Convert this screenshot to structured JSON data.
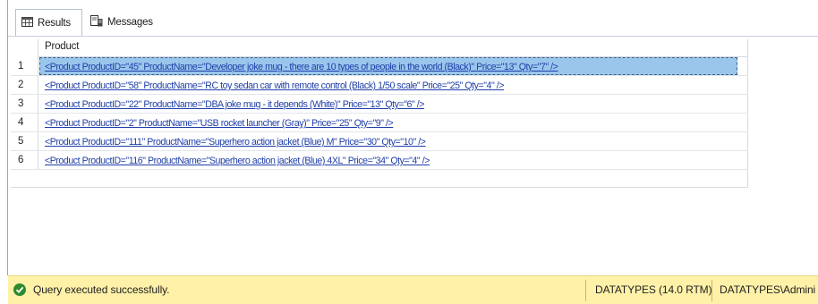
{
  "tabs": {
    "results_label": "Results",
    "messages_label": "Messages"
  },
  "grid": {
    "column_header": "Product",
    "rows": [
      {
        "num": "1",
        "value": "<Product ProductID=\"45\" ProductName=\"Developer joke mug - there are 10 types of people in the world (Black)\" Price=\"13\" Qty=\"7\" />"
      },
      {
        "num": "2",
        "value": "<Product ProductID=\"58\" ProductName=\"RC toy sedan car with remote control (Black) 1/50 scale\" Price=\"25\" Qty=\"4\" />"
      },
      {
        "num": "3",
        "value": "<Product ProductID=\"22\" ProductName=\"DBA joke mug - it depends (White)\" Price=\"13\" Qty=\"6\" />"
      },
      {
        "num": "4",
        "value": "<Product ProductID=\"2\" ProductName=\"USB rocket launcher (Gray)\" Price=\"25\" Qty=\"9\" />"
      },
      {
        "num": "5",
        "value": "<Product ProductID=\"111\" ProductName=\"Superhero action jacket (Blue) M\" Price=\"30\" Qty=\"10\" />"
      },
      {
        "num": "6",
        "value": "<Product ProductID=\"116\" ProductName=\"Superhero action jacket (Blue) 4XL\" Price=\"34\" Qty=\"4\" />"
      }
    ]
  },
  "status": {
    "message": "Query executed successfully.",
    "server": "DATATYPES (14.0 RTM)",
    "user": "DATATYPES\\Admini"
  },
  "colors": {
    "status_bg": "#fff1a8",
    "selected_row": "#9ac6ec",
    "link": "#1f3fa8"
  }
}
